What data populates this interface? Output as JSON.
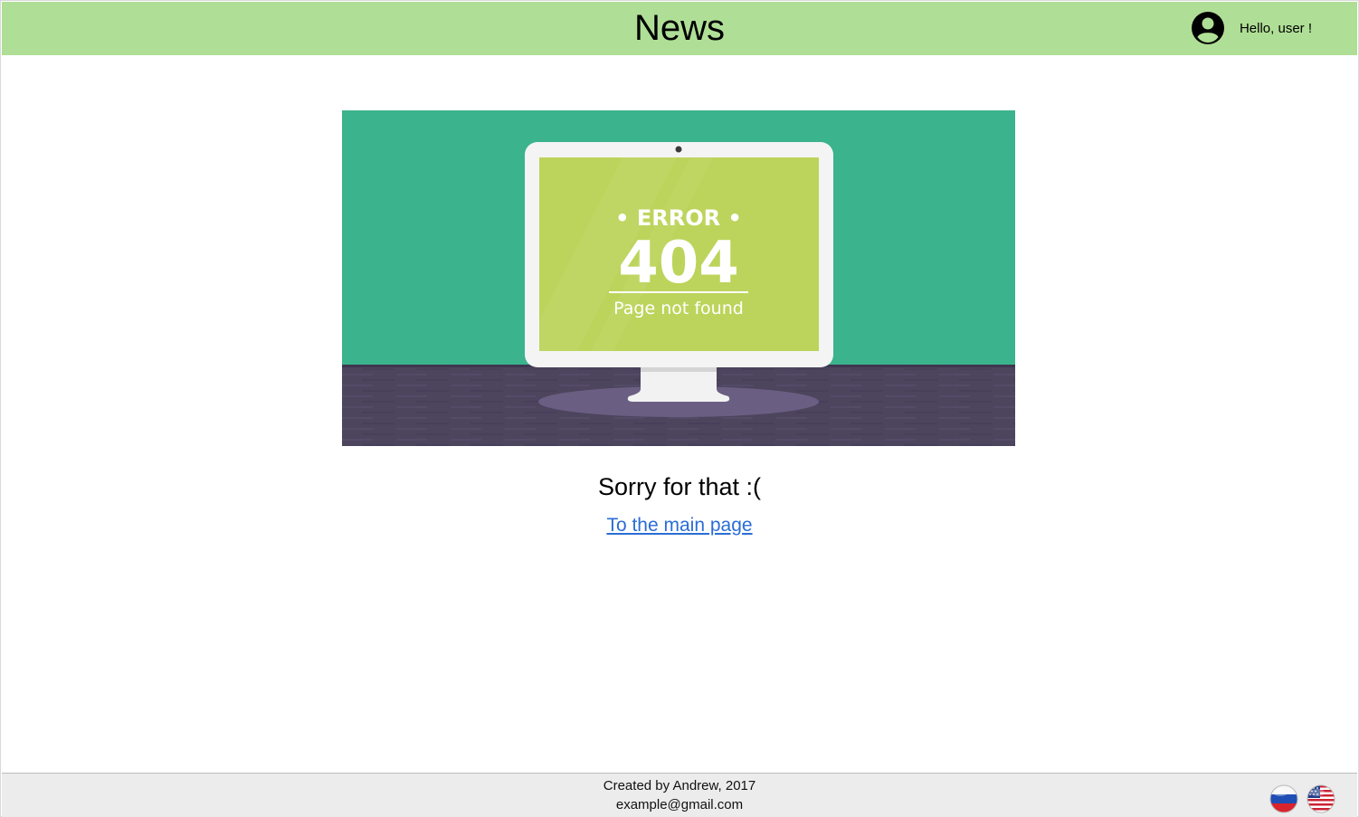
{
  "header": {
    "title": "News",
    "greeting": "Hello, user !",
    "avatar_icon": "account-circle-icon",
    "background": "#afdf96"
  },
  "hero": {
    "error_label": "• ERROR •",
    "error_code": "404",
    "error_message": "Page not found",
    "wall_color": "#3bb38c",
    "screen_color": "#bcd45b",
    "floor_color": "#4d445e"
  },
  "main": {
    "message": "Sorry for that :(",
    "link_label": "To the main page",
    "link_color": "#2a6dd6"
  },
  "footer": {
    "credit_line": "Created by Andrew, 2017",
    "email": "example@gmail.com",
    "languages": [
      {
        "code": "ru",
        "icon": "russia-flag-icon"
      },
      {
        "code": "en",
        "icon": "usa-flag-icon"
      }
    ]
  }
}
